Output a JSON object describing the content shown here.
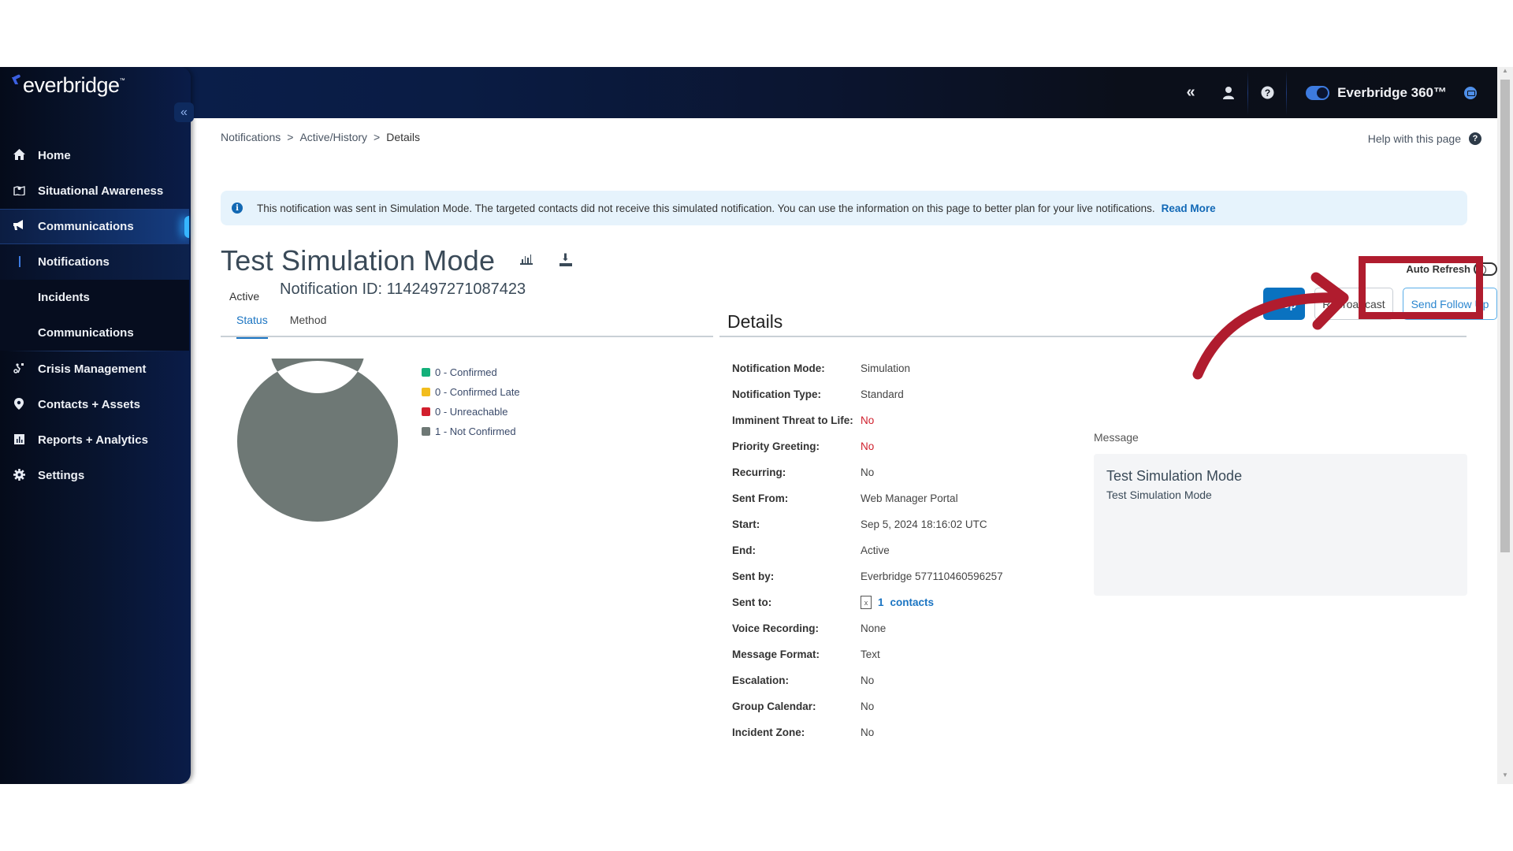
{
  "header": {
    "collapse_icon": "double-chevron-left-icon",
    "user_icon": "user-icon",
    "help_icon": "question-circle-icon",
    "product_toggle_label": "Everbridge 360™",
    "product_toggle_on": true,
    "chat_icon": "chat-icon"
  },
  "sidebar": {
    "logo_text": "everbridge",
    "logo_tm": "™",
    "collapse_label": "«",
    "items": [
      {
        "label": "Home",
        "icon": "home-icon"
      },
      {
        "label": "Situational Awareness",
        "icon": "map-icon"
      },
      {
        "label": "Communications",
        "icon": "megaphone-icon",
        "active": true
      },
      {
        "label": "Crisis Management",
        "icon": "route-icon"
      },
      {
        "label": "Contacts + Assets",
        "icon": "location-pin-icon"
      },
      {
        "label": "Reports + Analytics",
        "icon": "bar-chart-icon"
      },
      {
        "label": "Settings",
        "icon": "gear-icon"
      }
    ],
    "sub_items": [
      {
        "label": "Notifications",
        "selected": true
      },
      {
        "label": "Incidents"
      },
      {
        "label": "Communications"
      }
    ]
  },
  "breadcrumb": {
    "items": [
      "Notifications",
      "Active/History",
      "Details"
    ],
    "separator": ">"
  },
  "help_link": "Help with this page",
  "banner": {
    "text": "This notification was sent in Simulation Mode. The targeted contacts did not receive this simulated notification. You can use the information on this page to better plan for your live notifications.",
    "link": "Read More"
  },
  "notification": {
    "title": "Test Simulation Mode",
    "status": "Active",
    "id_label": "Notification ID: 1142497271087423"
  },
  "actions": {
    "auto_refresh_label": "Auto Refresh",
    "auto_refresh_on": false,
    "stop": "Stop",
    "rebroadcast": "Rebroadcast",
    "send_follow_up": "Send Follow Up"
  },
  "tabs": [
    {
      "label": "Status",
      "active": true
    },
    {
      "label": "Method",
      "active": false
    }
  ],
  "chart_data": {
    "type": "pie",
    "donut": true,
    "title": "",
    "legend_position": "right",
    "categories": [
      "Confirmed",
      "Confirmed Late",
      "Unreachable",
      "Not Confirmed"
    ],
    "values": [
      0,
      0,
      0,
      1
    ],
    "colors": [
      "#14b07a",
      "#f2bd1d",
      "#d21f2d",
      "#6e7875"
    ],
    "legend_labels": [
      "0 - Confirmed",
      "0 - Confirmed Late",
      "0 - Unreachable",
      "1 - Not Confirmed"
    ]
  },
  "details": {
    "heading": "Details",
    "rows": [
      {
        "label": "Notification Mode:",
        "value": "Simulation"
      },
      {
        "label": "Notification Type:",
        "value": "Standard"
      },
      {
        "label": "Imminent Threat to Life:",
        "value": "No",
        "alert": true
      },
      {
        "label": "Priority Greeting:",
        "value": "No",
        "alert": true
      },
      {
        "label": "Recurring:",
        "value": "No"
      },
      {
        "label": "Sent From:",
        "value": "Web Manager Portal"
      },
      {
        "label": "Start:",
        "value": "Sep 5, 2024 18:16:02 UTC"
      },
      {
        "label": "End:",
        "value": "Active"
      },
      {
        "label": "Sent by:",
        "value": "Everbridge 577110460596257"
      },
      {
        "label": "Sent to:",
        "value": "",
        "count": "1",
        "link": "contacts",
        "icon": "excel-file-icon"
      },
      {
        "label": "Voice Recording:",
        "value": "None"
      },
      {
        "label": "Message Format:",
        "value": "Text"
      },
      {
        "label": "Escalation:",
        "value": "No"
      },
      {
        "label": "Group Calendar:",
        "value": "No"
      },
      {
        "label": "Incident Zone:",
        "value": "No"
      }
    ]
  },
  "message": {
    "label": "Message",
    "title": "Test Simulation Mode",
    "body": "Test Simulation Mode"
  },
  "colors": {
    "primary": "#0a72c0",
    "alert": "#d0202d",
    "annotation": "#b01c2e",
    "banner_bg": "#e6f3fc"
  }
}
